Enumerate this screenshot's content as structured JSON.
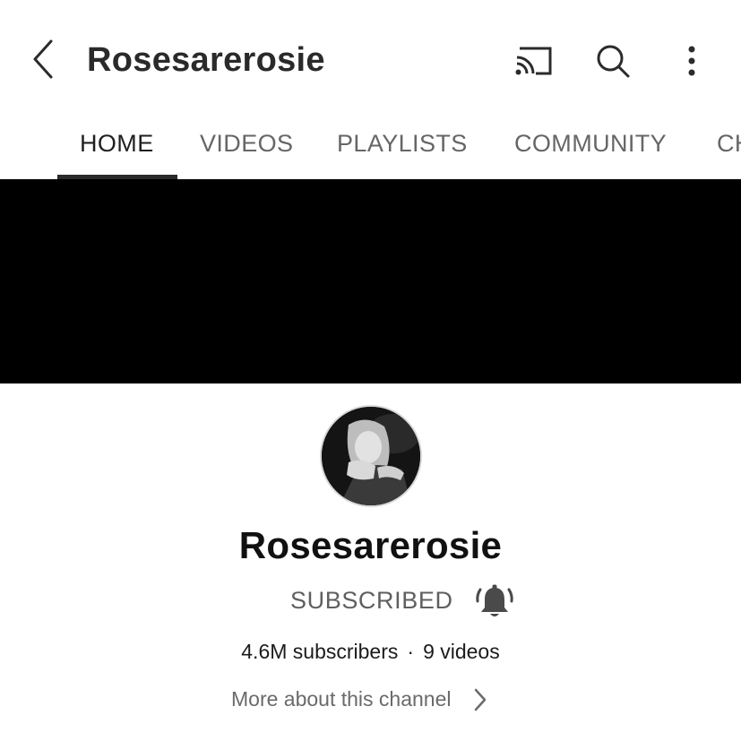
{
  "topbar": {
    "title": "Rosesarerosie",
    "icons": [
      "back-icon",
      "cast-icon",
      "search-icon",
      "more-vert-icon"
    ]
  },
  "tabs": [
    {
      "label": "HOME",
      "active": true
    },
    {
      "label": "VIDEOS",
      "active": false
    },
    {
      "label": "PLAYLISTS",
      "active": false
    },
    {
      "label": "COMMUNITY",
      "active": false
    },
    {
      "label": "CH",
      "active": false
    }
  ],
  "channel": {
    "name": "Rosesarerosie",
    "subscribe_label": "SUBSCRIBED",
    "subscribers": "4.6M subscribers",
    "separator": "·",
    "videos": "9 videos",
    "more_label": "More about this channel"
  },
  "colors": {
    "banner": "#000000",
    "text_primary": "#111111",
    "text_secondary": "#666666",
    "tab_underline": "#2b2b2b"
  }
}
